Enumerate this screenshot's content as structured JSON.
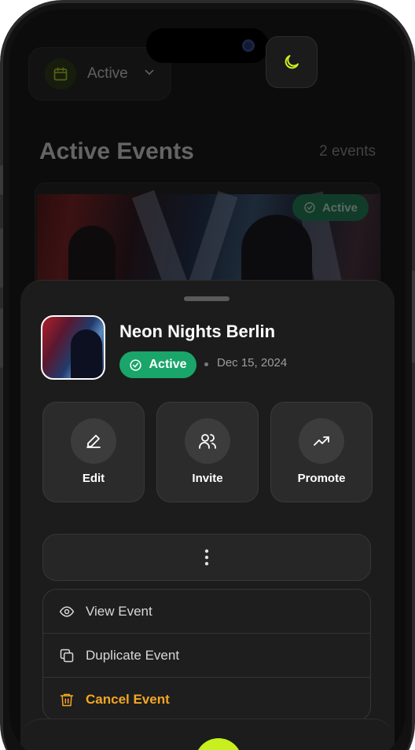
{
  "filter": {
    "label": "Active",
    "icon": "calendar-icon"
  },
  "theme_toggle": {
    "icon": "moon-icon"
  },
  "list": {
    "title": "Active Events",
    "count": "2 events"
  },
  "event_card": {
    "badge": "Active"
  },
  "sheet": {
    "event": {
      "title": "Neon Nights Berlin",
      "status": "Active",
      "date": "Dec 15, 2024"
    },
    "actions": [
      {
        "label": "Edit",
        "icon": "pencil-icon"
      },
      {
        "label": "Invite",
        "icon": "users-icon"
      },
      {
        "label": "Promote",
        "icon": "trending-up-icon"
      }
    ],
    "more_icon": "more-vertical-icon",
    "menu": [
      {
        "label": "View Event",
        "icon": "eye-icon"
      },
      {
        "label": "Duplicate Event",
        "icon": "copy-icon"
      },
      {
        "label": "Cancel Event",
        "icon": "trash-icon"
      }
    ]
  },
  "colors": {
    "accent": "#c8f01e",
    "active": "#1aa56a",
    "danger": "#f5a623",
    "sheet_bg": "#1c1c1c"
  }
}
